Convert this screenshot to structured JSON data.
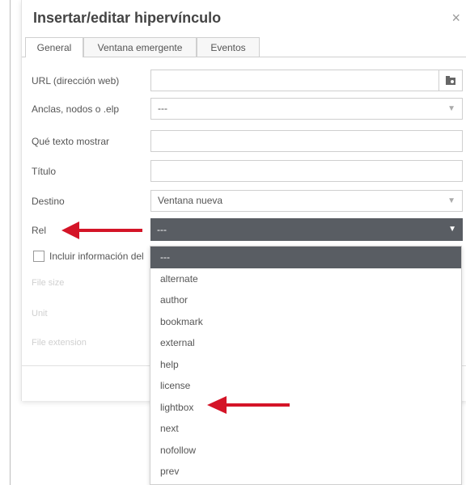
{
  "dialog": {
    "title": "Insertar/editar hipervínculo",
    "close_glyph": "×"
  },
  "tabs": [
    {
      "label": "General"
    },
    {
      "label": "Ventana emergente"
    },
    {
      "label": "Eventos"
    }
  ],
  "fields": {
    "url": {
      "label": "URL (dirección web)",
      "value": ""
    },
    "anchors": {
      "label": "Anclas, nodos o .elp",
      "value": "---"
    },
    "text": {
      "label": "Qué texto mostrar",
      "value": ""
    },
    "title": {
      "label": "Título",
      "value": ""
    },
    "target": {
      "label": "Destino",
      "value": "Ventana nueva"
    },
    "rel": {
      "label": "Rel",
      "value": "---"
    }
  },
  "checkbox": {
    "label": "Incluir información del"
  },
  "faded_fields": {
    "file_size": "File size",
    "unit": "Unit",
    "file_extension": "File extension"
  },
  "rel_options": [
    "---",
    "alternate",
    "author",
    "bookmark",
    "external",
    "help",
    "license",
    "lightbox",
    "next",
    "nofollow",
    "prev"
  ],
  "colors": {
    "selected_bg": "#595d63",
    "arrow": "#d41427"
  }
}
